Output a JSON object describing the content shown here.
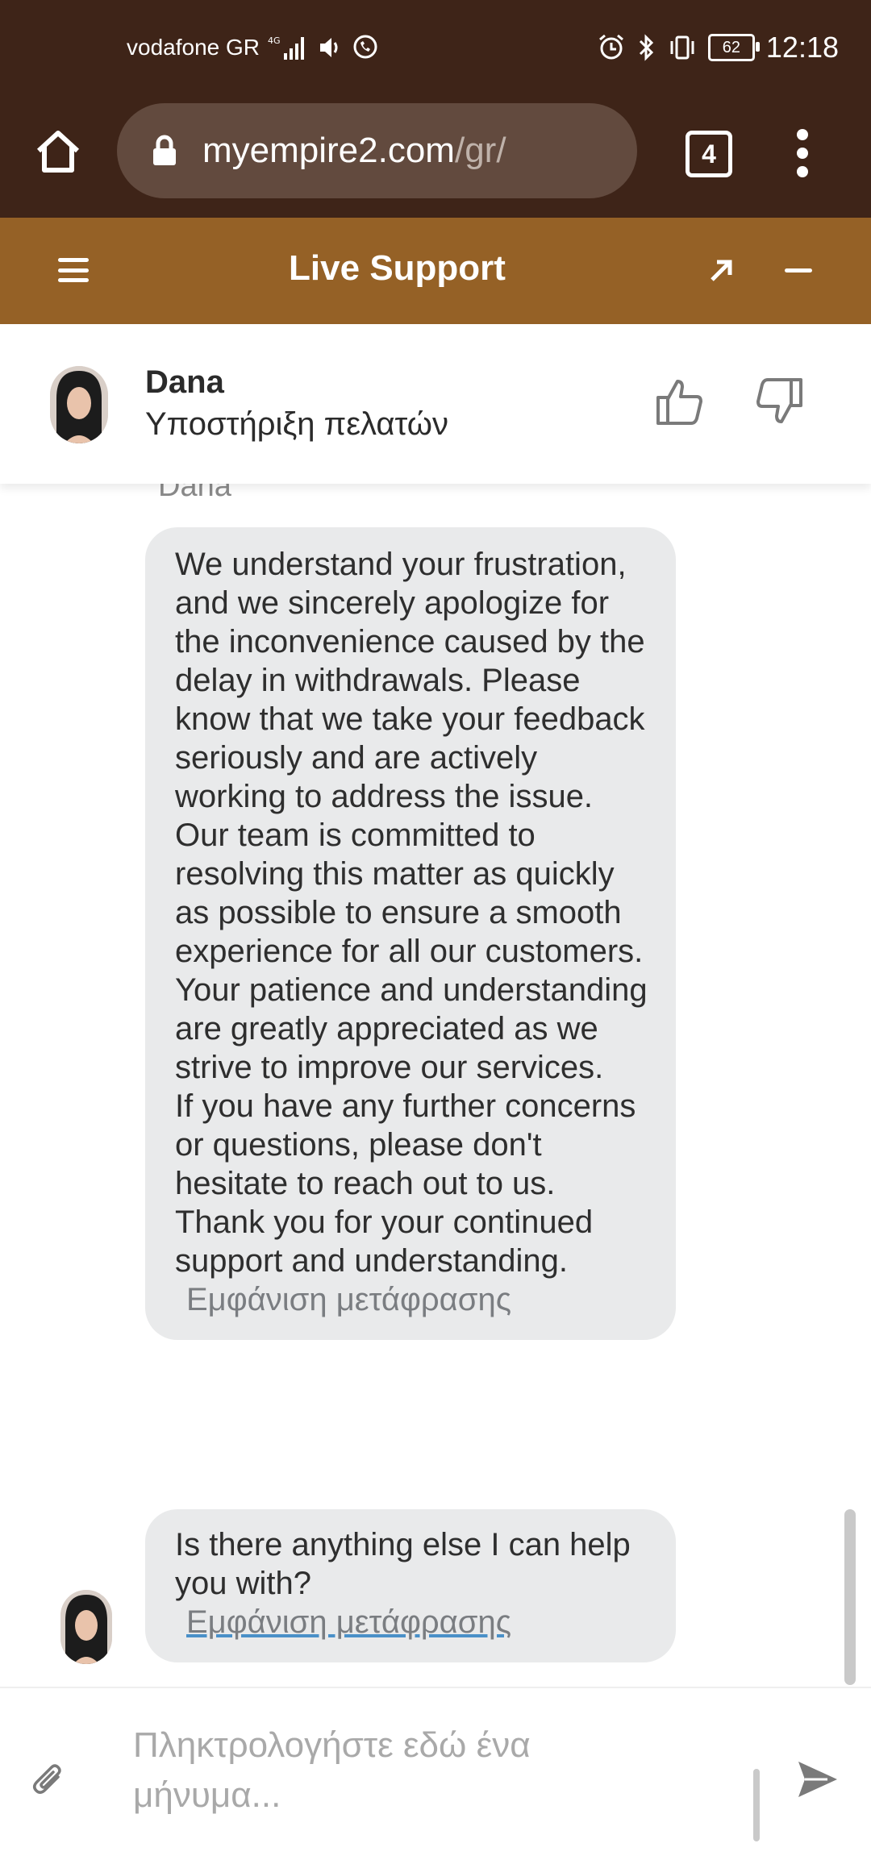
{
  "status_bar": {
    "carrier": "vodafone GR",
    "network": "4G",
    "battery": "62",
    "time": "12:18"
  },
  "browser": {
    "url_domain": "myempire2.com",
    "url_path": "/gr/",
    "tab_count": "4"
  },
  "support_header": {
    "title": "Live Support"
  },
  "agent": {
    "name": "Dana",
    "role": "Υποστήριξη πελατών"
  },
  "chat": {
    "sender_label": "Dana",
    "messages": [
      {
        "paragraphs": [
          "We understand your frustration, and we sincerely apologize for the inconvenience caused by the delay in withdrawals. Please know that we take your feedback seriously and are actively working to address the issue.",
          "Our team is committed to resolving this matter as quickly as possible to ensure a smooth experience for all our customers. Your patience and understanding are greatly appreciated as we strive to improve our services.",
          "If you have any further concerns or questions, please don't hesitate to reach out to us.",
          "Thank you for your continued support and understanding."
        ],
        "translate_label": "Εμφάνιση μετάφρασης"
      },
      {
        "paragraphs": [
          "Is there anything else I can help you with?"
        ],
        "translate_label": "Εμφάνιση μετάφρασης"
      }
    ]
  },
  "composer": {
    "placeholder": "Πληκτρολογήστε εδώ ένα μήνυμα..."
  },
  "colors": {
    "status_bg": "#3e2418",
    "header_bg": "#956126",
    "bubble_bg": "#e9eaeb"
  }
}
